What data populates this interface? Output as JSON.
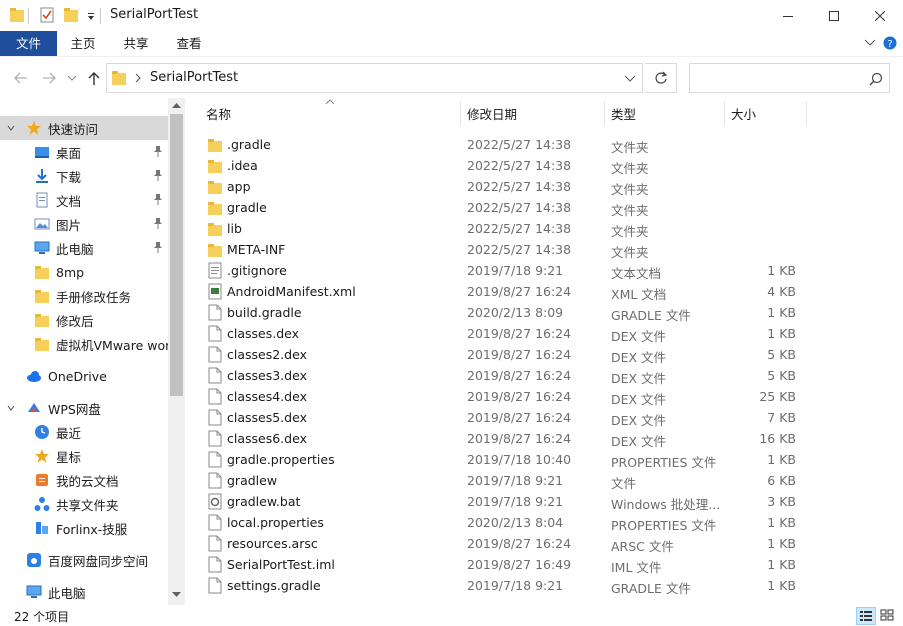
{
  "window": {
    "title": "SerialPortTest"
  },
  "ribbon": {
    "tabs": [
      "文件",
      "主页",
      "共享",
      "查看"
    ]
  },
  "address": {
    "path": "SerialPortTest",
    "search_placeholder": ""
  },
  "nav": {
    "items": [
      {
        "label": "快速访问",
        "icon": "star-icon",
        "pinned": false,
        "selected": true
      },
      {
        "label": "桌面",
        "icon": "desktop-icon",
        "pinned": true
      },
      {
        "label": "下载",
        "icon": "download-icon",
        "pinned": true
      },
      {
        "label": "文档",
        "icon": "document-icon",
        "pinned": true
      },
      {
        "label": "图片",
        "icon": "picture-icon",
        "pinned": true
      },
      {
        "label": "此电脑",
        "icon": "computer-icon",
        "pinned": true
      },
      {
        "label": "8mp",
        "icon": "folder-icon",
        "pinned": false
      },
      {
        "label": "手册修改任务",
        "icon": "folder-icon",
        "pinned": false
      },
      {
        "label": "修改后",
        "icon": "folder-icon",
        "pinned": false
      },
      {
        "label": "虚拟机VMware work",
        "icon": "folder-icon",
        "pinned": false
      },
      {
        "label": "OneDrive",
        "icon": "cloud-icon",
        "pinned": false
      },
      {
        "label": "WPS网盘",
        "icon": "wps-cloud-icon",
        "pinned": false
      },
      {
        "label": "最近",
        "icon": "clock-icon",
        "pinned": false
      },
      {
        "label": "星标",
        "icon": "star-icon",
        "pinned": false
      },
      {
        "label": "我的云文档",
        "icon": "cloud-doc-icon",
        "pinned": false
      },
      {
        "label": "共享文件夹",
        "icon": "share-icon",
        "pinned": false
      },
      {
        "label": "Forlinx-技服",
        "icon": "team-icon",
        "pinned": false
      },
      {
        "label": "百度网盘同步空间",
        "icon": "baidu-cloud-icon",
        "pinned": false
      },
      {
        "label": "此电脑",
        "icon": "computer-icon",
        "pinned": false
      }
    ]
  },
  "columns": {
    "name": "名称",
    "date": "修改日期",
    "type": "类型",
    "size": "大小"
  },
  "files": [
    {
      "name": ".gradle",
      "date": "2022/5/27 14:38",
      "type": "文件夹",
      "size": "",
      "kind": "folder"
    },
    {
      "name": ".idea",
      "date": "2022/5/27 14:38",
      "type": "文件夹",
      "size": "",
      "kind": "folder"
    },
    {
      "name": "app",
      "date": "2022/5/27 14:38",
      "type": "文件夹",
      "size": "",
      "kind": "folder"
    },
    {
      "name": "gradle",
      "date": "2022/5/27 14:38",
      "type": "文件夹",
      "size": "",
      "kind": "folder"
    },
    {
      "name": "lib",
      "date": "2022/5/27 14:38",
      "type": "文件夹",
      "size": "",
      "kind": "folder"
    },
    {
      "name": "META-INF",
      "date": "2022/5/27 14:38",
      "type": "文件夹",
      "size": "",
      "kind": "folder"
    },
    {
      "name": ".gitignore",
      "date": "2019/7/18 9:21",
      "type": "文本文档",
      "size": "1 KB",
      "kind": "text"
    },
    {
      "name": "AndroidManifest.xml",
      "date": "2019/8/27 16:24",
      "type": "XML 文档",
      "size": "4 KB",
      "kind": "xml"
    },
    {
      "name": "build.gradle",
      "date": "2020/2/13 8:09",
      "type": "GRADLE 文件",
      "size": "1 KB",
      "kind": "file"
    },
    {
      "name": "classes.dex",
      "date": "2019/8/27 16:24",
      "type": "DEX 文件",
      "size": "1 KB",
      "kind": "file"
    },
    {
      "name": "classes2.dex",
      "date": "2019/8/27 16:24",
      "type": "DEX 文件",
      "size": "5 KB",
      "kind": "file"
    },
    {
      "name": "classes3.dex",
      "date": "2019/8/27 16:24",
      "type": "DEX 文件",
      "size": "5 KB",
      "kind": "file"
    },
    {
      "name": "classes4.dex",
      "date": "2019/8/27 16:24",
      "type": "DEX 文件",
      "size": "25 KB",
      "kind": "file"
    },
    {
      "name": "classes5.dex",
      "date": "2019/8/27 16:24",
      "type": "DEX 文件",
      "size": "7 KB",
      "kind": "file"
    },
    {
      "name": "classes6.dex",
      "date": "2019/8/27 16:24",
      "type": "DEX 文件",
      "size": "16 KB",
      "kind": "file"
    },
    {
      "name": "gradle.properties",
      "date": "2019/7/18 10:40",
      "type": "PROPERTIES 文件",
      "size": "1 KB",
      "kind": "file"
    },
    {
      "name": "gradlew",
      "date": "2019/7/18 9:21",
      "type": "文件",
      "size": "6 KB",
      "kind": "file"
    },
    {
      "name": "gradlew.bat",
      "date": "2019/7/18 9:21",
      "type": "Windows 批处理...",
      "size": "3 KB",
      "kind": "bat"
    },
    {
      "name": "local.properties",
      "date": "2020/2/13 8:04",
      "type": "PROPERTIES 文件",
      "size": "1 KB",
      "kind": "file"
    },
    {
      "name": "resources.arsc",
      "date": "2019/8/27 16:24",
      "type": "ARSC 文件",
      "size": "1 KB",
      "kind": "file"
    },
    {
      "name": "SerialPortTest.iml",
      "date": "2019/8/27 16:49",
      "type": "IML 文件",
      "size": "1 KB",
      "kind": "file"
    },
    {
      "name": "settings.gradle",
      "date": "2019/7/18 9:21",
      "type": "GRADLE 文件",
      "size": "1 KB",
      "kind": "file"
    }
  ],
  "status": {
    "count": "22 个项目"
  },
  "colors": {
    "file_tab": "#1f4e9c",
    "folder": "#f7cf5b",
    "selected_nav": "#d9d9d9"
  }
}
